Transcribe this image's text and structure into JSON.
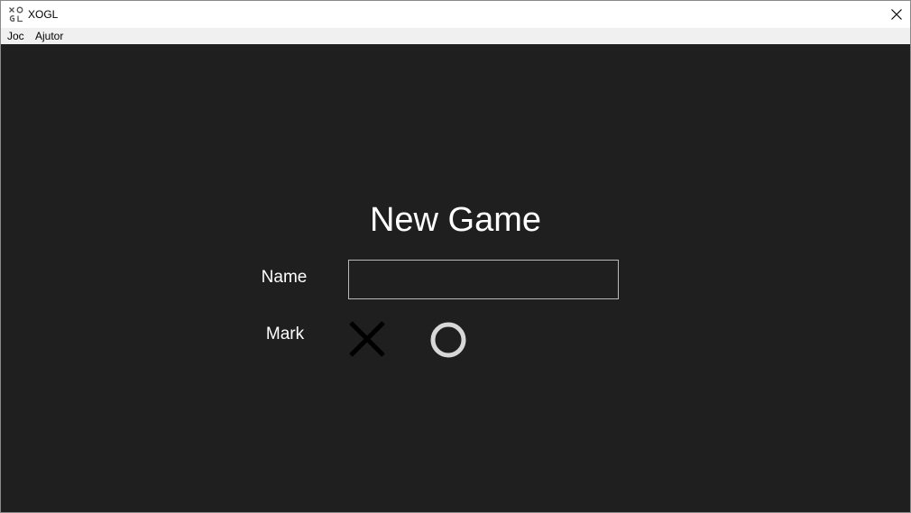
{
  "window": {
    "title": "XOGL",
    "icon": "xogl-app-icon",
    "close_icon": "close-icon",
    "background_color": "#1f1f1f"
  },
  "menu": {
    "items": [
      {
        "label": "Joc"
      },
      {
        "label": "Ajutor"
      }
    ]
  },
  "new_game": {
    "heading": "New Game",
    "name_label": "Name",
    "name_value": "",
    "mark_label": "Mark",
    "marks": [
      {
        "icon": "x-mark-icon",
        "color": "#000000"
      },
      {
        "icon": "o-mark-icon",
        "color": "#d8d8d8"
      }
    ]
  }
}
